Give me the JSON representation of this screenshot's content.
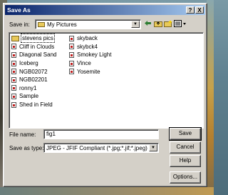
{
  "window": {
    "title": "Save As",
    "help_button": "?",
    "close_button": "X"
  },
  "save_in": {
    "label": "Save in:",
    "value": "My Pictures"
  },
  "toolbar": {
    "back_icon": "back-arrow-icon",
    "up_icon": "up-folder-icon",
    "new_folder_icon": "new-folder-icon",
    "view_icon": "view-menu-icon"
  },
  "files_col1": [
    {
      "name": "stevens pics",
      "type": "folder"
    },
    {
      "name": "Cliff in Clouds",
      "type": "file"
    },
    {
      "name": "Diagonal Sand",
      "type": "file"
    },
    {
      "name": "Iceberg",
      "type": "file"
    },
    {
      "name": "NGB02072",
      "type": "file"
    },
    {
      "name": "NGB02201",
      "type": "file"
    },
    {
      "name": "ronny1",
      "type": "file"
    },
    {
      "name": "Sample",
      "type": "file"
    },
    {
      "name": "Shed in Field",
      "type": "file"
    }
  ],
  "files_col2": [
    {
      "name": "skyback",
      "type": "file"
    },
    {
      "name": "skybck4",
      "type": "file"
    },
    {
      "name": "Smokey Light",
      "type": "file"
    },
    {
      "name": "Vince",
      "type": "file"
    },
    {
      "name": "Yosemite",
      "type": "file"
    }
  ],
  "file_name": {
    "label": "File name:",
    "value": "fig1"
  },
  "save_as_type": {
    "label": "Save as type:",
    "value": "JPEG - JFIF Compliant (*.jpg;*.jif;*.jpeg)"
  },
  "buttons": {
    "save": "Save",
    "cancel": "Cancel",
    "help": "Help",
    "options": "Options..."
  }
}
